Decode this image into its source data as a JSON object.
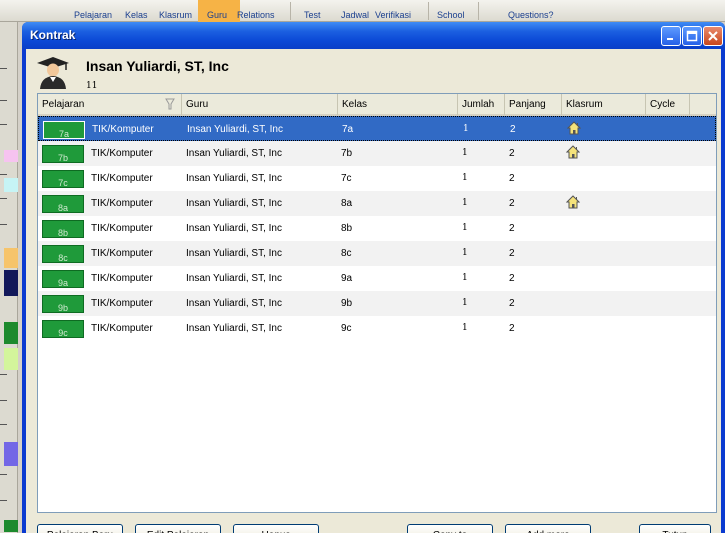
{
  "background": {
    "tabs": [
      "Pelajaran",
      "Kelas",
      "Klasrum",
      "Guru",
      "Relations",
      "Test",
      "Jadwal",
      "Verifikasi",
      "School",
      "Questions?"
    ]
  },
  "window": {
    "title": "Kontrak",
    "controls": [
      "minimize-icon",
      "maximize-icon",
      "close-icon"
    ]
  },
  "teacher": {
    "name": "Insan Yuliardi, ST, Inc",
    "count": "11",
    "icon": "graduate-avatar-icon"
  },
  "columns": [
    "Pelajaran",
    "Guru",
    "Kelas",
    "Jumlah",
    "Panjang",
    "Klasrum",
    "Cycle"
  ],
  "rows": [
    {
      "chip": "7a",
      "subject": "TIK/Komputer",
      "guru": "Insan Yuliardi, ST, Inc",
      "kelas": "7a",
      "jumlah": "1",
      "panjang": "2",
      "klasrum": "home-icon",
      "cycle": "",
      "selected": true
    },
    {
      "chip": "7b",
      "subject": "TIK/Komputer",
      "guru": "Insan Yuliardi, ST, Inc",
      "kelas": "7b",
      "jumlah": "1",
      "panjang": "2",
      "klasrum": "home-icon",
      "cycle": "",
      "selected": false
    },
    {
      "chip": "7c",
      "subject": "TIK/Komputer",
      "guru": "Insan Yuliardi, ST, Inc",
      "kelas": "7c",
      "jumlah": "1",
      "panjang": "2",
      "klasrum": "",
      "cycle": "",
      "selected": false
    },
    {
      "chip": "8a",
      "subject": "TIK/Komputer",
      "guru": "Insan Yuliardi, ST, Inc",
      "kelas": "8a",
      "jumlah": "1",
      "panjang": "2",
      "klasrum": "home-icon",
      "cycle": "",
      "selected": false
    },
    {
      "chip": "8b",
      "subject": "TIK/Komputer",
      "guru": "Insan Yuliardi, ST, Inc",
      "kelas": "8b",
      "jumlah": "1",
      "panjang": "2",
      "klasrum": "",
      "cycle": "",
      "selected": false
    },
    {
      "chip": "8c",
      "subject": "TIK/Komputer",
      "guru": "Insan Yuliardi, ST, Inc",
      "kelas": "8c",
      "jumlah": "1",
      "panjang": "2",
      "klasrum": "",
      "cycle": "",
      "selected": false
    },
    {
      "chip": "9a",
      "subject": "TIK/Komputer",
      "guru": "Insan Yuliardi, ST, Inc",
      "kelas": "9a",
      "jumlah": "1",
      "panjang": "2",
      "klasrum": "",
      "cycle": "",
      "selected": false
    },
    {
      "chip": "9b",
      "subject": "TIK/Komputer",
      "guru": "Insan Yuliardi, ST, Inc",
      "kelas": "9b",
      "jumlah": "1",
      "panjang": "2",
      "klasrum": "",
      "cycle": "",
      "selected": false
    },
    {
      "chip": "9c",
      "subject": "TIK/Komputer",
      "guru": "Insan Yuliardi, ST, Inc",
      "kelas": "9c",
      "jumlah": "1",
      "panjang": "2",
      "klasrum": "",
      "cycle": "",
      "selected": false
    }
  ],
  "buttons": {
    "new": "Pelajaran Baru",
    "edit": "Edit Pelajaran",
    "delete": "Hapus",
    "copy": "Copy to",
    "add_more": "Add more",
    "close": "Tutup"
  },
  "colors": {
    "selection": "#316ac5",
    "chip": "#1f9a3a",
    "titlebar": "#0b48d6"
  }
}
